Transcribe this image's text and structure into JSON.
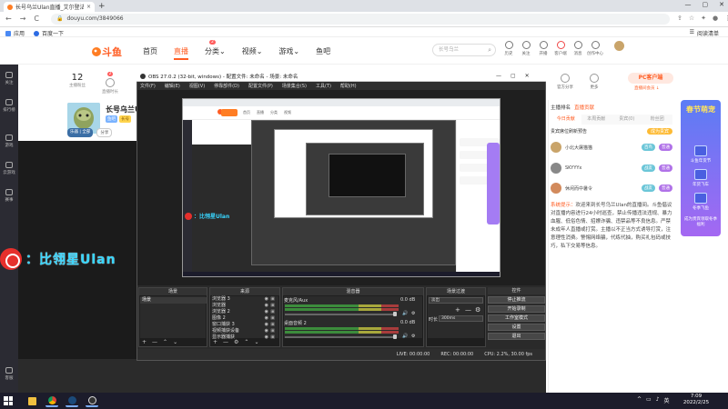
{
  "browser": {
    "tab_title": "长号乌兰Ulan直播_艾尔登法环直…",
    "tab_close": "×",
    "new_tab": "+",
    "window_controls": [
      "—",
      "▢",
      "✕"
    ],
    "nav": [
      "←",
      "→",
      "C"
    ],
    "url": "douyu.com/3849066",
    "bookmarks": [
      "应用",
      "百度一下"
    ],
    "reading_list": "阅读清单"
  },
  "douyu": {
    "logo_text": "斗鱼",
    "nav": [
      "首页",
      "直播",
      "分类",
      "视频",
      "游戏",
      "鱼吧"
    ],
    "nav_badges": [
      "",
      "2",
      "",
      "",
      "",
      ""
    ],
    "search_placeholder": "长号乌兰",
    "header_icons": [
      "历史",
      "关注",
      "开播",
      "客户端",
      "消息",
      "创作中心"
    ],
    "fans": "12",
    "fans_label": "主播粉丝",
    "rank_label": "直播时长",
    "room_right": [
      "官方分享",
      "更多"
    ],
    "pc_button": "PC客户端",
    "pc_sub": "直播间会员 ↓"
  },
  "streamer": {
    "name": "长号乌兰Ulan直",
    "tags": [
      "鱼吧",
      "长号"
    ],
    "badges": [
      "乐器 | 全部",
      "分享"
    ]
  },
  "watermark": {
    "text": "：比翎星Ulan",
    "mini_text": "：比翎星Ulan"
  },
  "obs": {
    "title": "OBS 27.0.2 (32-bit, windows) - 配置文件: 未命名 - 场景: 未命名",
    "menu": [
      "文件(F)",
      "编辑(E)",
      "视图(V)",
      "停靠部件(D)",
      "配置文件(P)",
      "场景集合(S)",
      "工具(T)",
      "帮助(H)"
    ],
    "docks": {
      "scenes": "场景",
      "sources": "来源",
      "mixer": "混音器",
      "transitions": "场景过渡",
      "controls": "控件"
    },
    "scene_items": [
      "场景"
    ],
    "sources": [
      "浏览器 3",
      "浏览器",
      "浏览器 2",
      "图像 2",
      "窗口捕获 3",
      "视频捕获设备",
      "显示器捕获"
    ],
    "mixer_channels": [
      {
        "name": "麦克风/Aux",
        "db": "0.0 dB"
      },
      {
        "name": "桌面音频 2",
        "db": "0.0 dB"
      }
    ],
    "transition_type": "淡出",
    "transition_duration_label": "时长",
    "transition_duration": "300ms",
    "controls": [
      "停止推流",
      "开始录制",
      "工作室模式",
      "设置",
      "退出"
    ],
    "status": [
      "LIVE: 00:00:00",
      "REC: 00:00:00",
      "CPU: 2.2%, 30.00 fps"
    ],
    "dock_foot": [
      "+",
      "—",
      "⌃",
      "⌄"
    ]
  },
  "right_panel": {
    "top_tabs": [
      "主播排名",
      "直播贡献"
    ],
    "tabs": [
      "今日贡献",
      "本周贡献",
      "贵宾(0)",
      "粉丝团"
    ],
    "sub_title": "贵宾席位刷新预告",
    "sub_button": "成为贵宾",
    "rank_rows": [
      {
        "name": "小北大屠猫猫",
        "badge": "百鸟",
        "badge2": "普通"
      },
      {
        "name": "SKYYYx",
        "badge": "战友",
        "badge2": "普通"
      },
      {
        "name": "休闲而中暑令",
        "badge": "战友",
        "badge2": "普通"
      }
    ],
    "system_tag": "系统提示：",
    "system_msg": "欢迎来到长号乌兰Ulan的直播间。斗鱼倡议对直播内容进行24小时巡查，禁止传播违法违规、暴力血腥、低俗色情、招嫖诈骗、违禁品等不良信息。严禁未成年人直播或打赏。主播以不正当方式诱导打赏，注意理性消费。警惕网络骗，代练代抽，购买礼包码或技巧，私下交易等信息。"
  },
  "promo": {
    "title": "春节萌宠",
    "items": [
      "斗鱼年货节",
      "年货飞车",
      "冬季飞鱼",
      "成为贵宾领取冬季福利"
    ]
  },
  "left_sidebar": [
    "关注",
    "排行榜",
    "游戏",
    "云游戏",
    "赛事",
    "客服"
  ],
  "taskbar": {
    "tray": [
      "^",
      "▭",
      "♪",
      "英"
    ],
    "time": "7:09",
    "date": "2022/2/25"
  }
}
